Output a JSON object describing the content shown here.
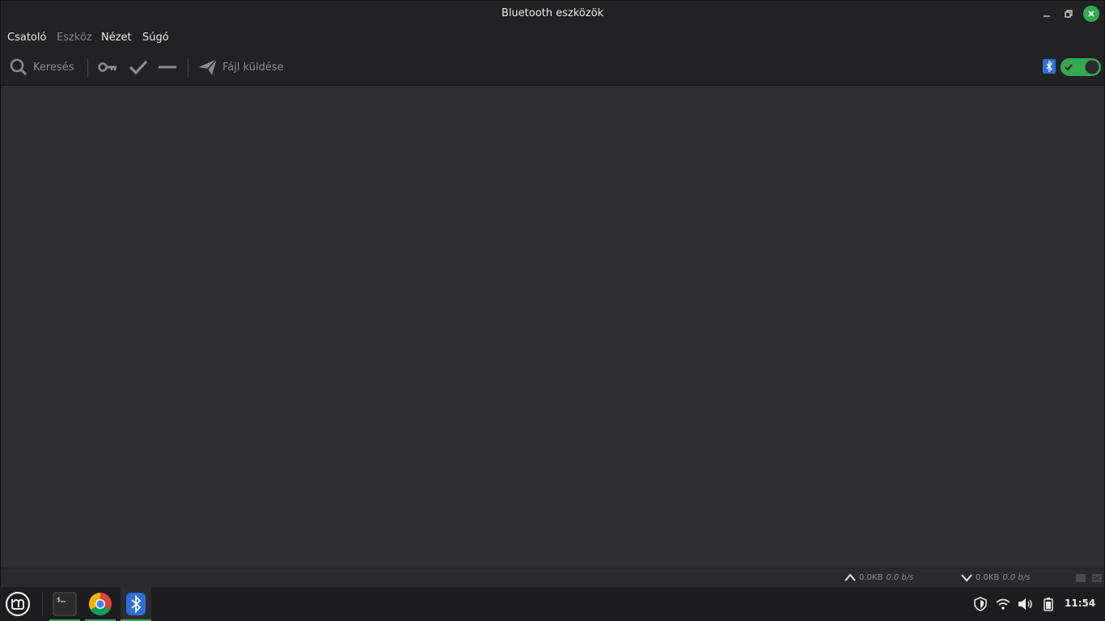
{
  "window": {
    "title": "Bluetooth eszközök"
  },
  "menu": {
    "items": [
      {
        "label": "Csatoló",
        "enabled": true
      },
      {
        "label": "Eszköz",
        "enabled": false
      },
      {
        "label": "Nézet",
        "enabled": true
      },
      {
        "label": "Súgó",
        "enabled": true
      }
    ]
  },
  "toolbar": {
    "search_label": "Keresés",
    "send_file_label": "Fájl küldése",
    "bluetooth_toggle": "on"
  },
  "statusbar": {
    "upload_total": "0.0KB",
    "upload_rate": "0.0 b/s",
    "download_total": "0.0KB",
    "download_rate": "0.0 b/s"
  },
  "taskbar": {
    "clock": "11:54",
    "apps": [
      "terminal",
      "chrome",
      "bluetooth-manager"
    ]
  },
  "colors": {
    "accent": "#35a852",
    "window_bg": "#2f2f33",
    "bar_bg": "#222224"
  }
}
